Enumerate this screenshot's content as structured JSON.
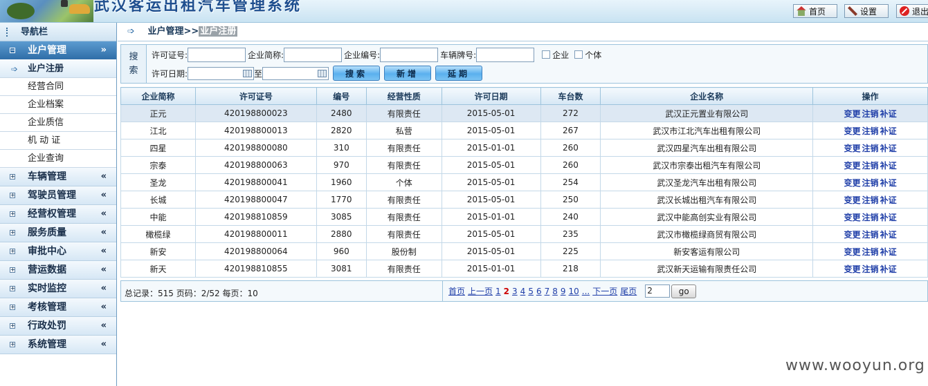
{
  "app_title": "武汉客运出租汽车管理系统",
  "header_buttons": {
    "home": "首页",
    "settings": "设置",
    "logout": "退出"
  },
  "sidebar": {
    "title": "导航栏",
    "groups": [
      {
        "label": "业户管理",
        "expanded": true,
        "chev": "»"
      },
      {
        "label": "车辆管理",
        "chev": "«"
      },
      {
        "label": "驾驶员管理",
        "chev": "«"
      },
      {
        "label": "经营权管理",
        "chev": "«"
      },
      {
        "label": "服务质量",
        "chev": "«"
      },
      {
        "label": "审批中心",
        "chev": "«"
      },
      {
        "label": "营运数据",
        "chev": "«"
      },
      {
        "label": "实时监控",
        "chev": "«"
      },
      {
        "label": "考核管理",
        "chev": "«"
      },
      {
        "label": "行政处罚",
        "chev": "«"
      },
      {
        "label": "系统管理",
        "chev": "«"
      }
    ],
    "sub_items": [
      "业户注册",
      "经营合同",
      "企业档案",
      "企业质信",
      "机 动 证",
      "企业查询"
    ]
  },
  "breadcrumb": {
    "parent": "业户管理>>",
    "current": "业户注册"
  },
  "search": {
    "label_a": "搜",
    "label_b": "索",
    "license_label": "许可证号:",
    "short_name_label": "企业简称:",
    "company_no_label": "企业编号:",
    "plate_label": "车辆牌号:",
    "cb_company": "企业",
    "cb_individual": "个体",
    "date_label": "许可日期:",
    "to_label": "至",
    "search_btn": "搜索",
    "add_btn": "新增",
    "extend_btn": "延期"
  },
  "table": {
    "headers": [
      "企业简称",
      "许可证号",
      "编号",
      "经营性质",
      "许可日期",
      "车台数",
      "企业名称",
      "操作"
    ],
    "ops": [
      "变更",
      "注销",
      "补证"
    ],
    "rows": [
      [
        "正元",
        "420198800023",
        "2480",
        "有限责任",
        "2015-05-01",
        "272",
        "武汉正元置业有限公司"
      ],
      [
        "江北",
        "420198800013",
        "2820",
        "私营",
        "2015-05-01",
        "267",
        "武汉市江北汽车出租有限公司"
      ],
      [
        "四星",
        "420198800080",
        "310",
        "有限责任",
        "2015-01-01",
        "260",
        "武汉四星汽车出租有限公司"
      ],
      [
        "宗泰",
        "420198800063",
        "970",
        "有限责任",
        "2015-05-01",
        "260",
        "武汉市宗泰出租汽车有限公司"
      ],
      [
        "圣龙",
        "420198800041",
        "1960",
        "个体",
        "2015-05-01",
        "254",
        "武汉圣龙汽车出租有限公司"
      ],
      [
        "长城",
        "420198800047",
        "1770",
        "有限责任",
        "2015-05-01",
        "250",
        "武汉长城出租汽车有限公司"
      ],
      [
        "中能",
        "420198810859",
        "3085",
        "有限责任",
        "2015-01-01",
        "240",
        "武汉中能高创实业有限公司"
      ],
      [
        "橄榄绿",
        "420198800011",
        "2880",
        "有限责任",
        "2015-05-01",
        "235",
        "武汉市橄榄绿商贸有限公司"
      ],
      [
        "新安",
        "420198800064",
        "960",
        "股份制",
        "2015-05-01",
        "225",
        "新安客运有限公司"
      ],
      [
        "新天",
        "420198810855",
        "3081",
        "有限责任",
        "2015-01-01",
        "218",
        "武汉新天运输有限责任公司"
      ]
    ]
  },
  "pager": {
    "info": "总记录：515 页码：2/52 每页：10",
    "first": "首页",
    "prev": "上一页",
    "pages": [
      "1",
      "2",
      "3",
      "4",
      "5",
      "6",
      "7",
      "8",
      "9",
      "10",
      "..."
    ],
    "current_page": "2",
    "next": "下一页",
    "last": "尾页",
    "input_value": "2",
    "go": "go"
  },
  "watermark": "www.wooyun.org"
}
